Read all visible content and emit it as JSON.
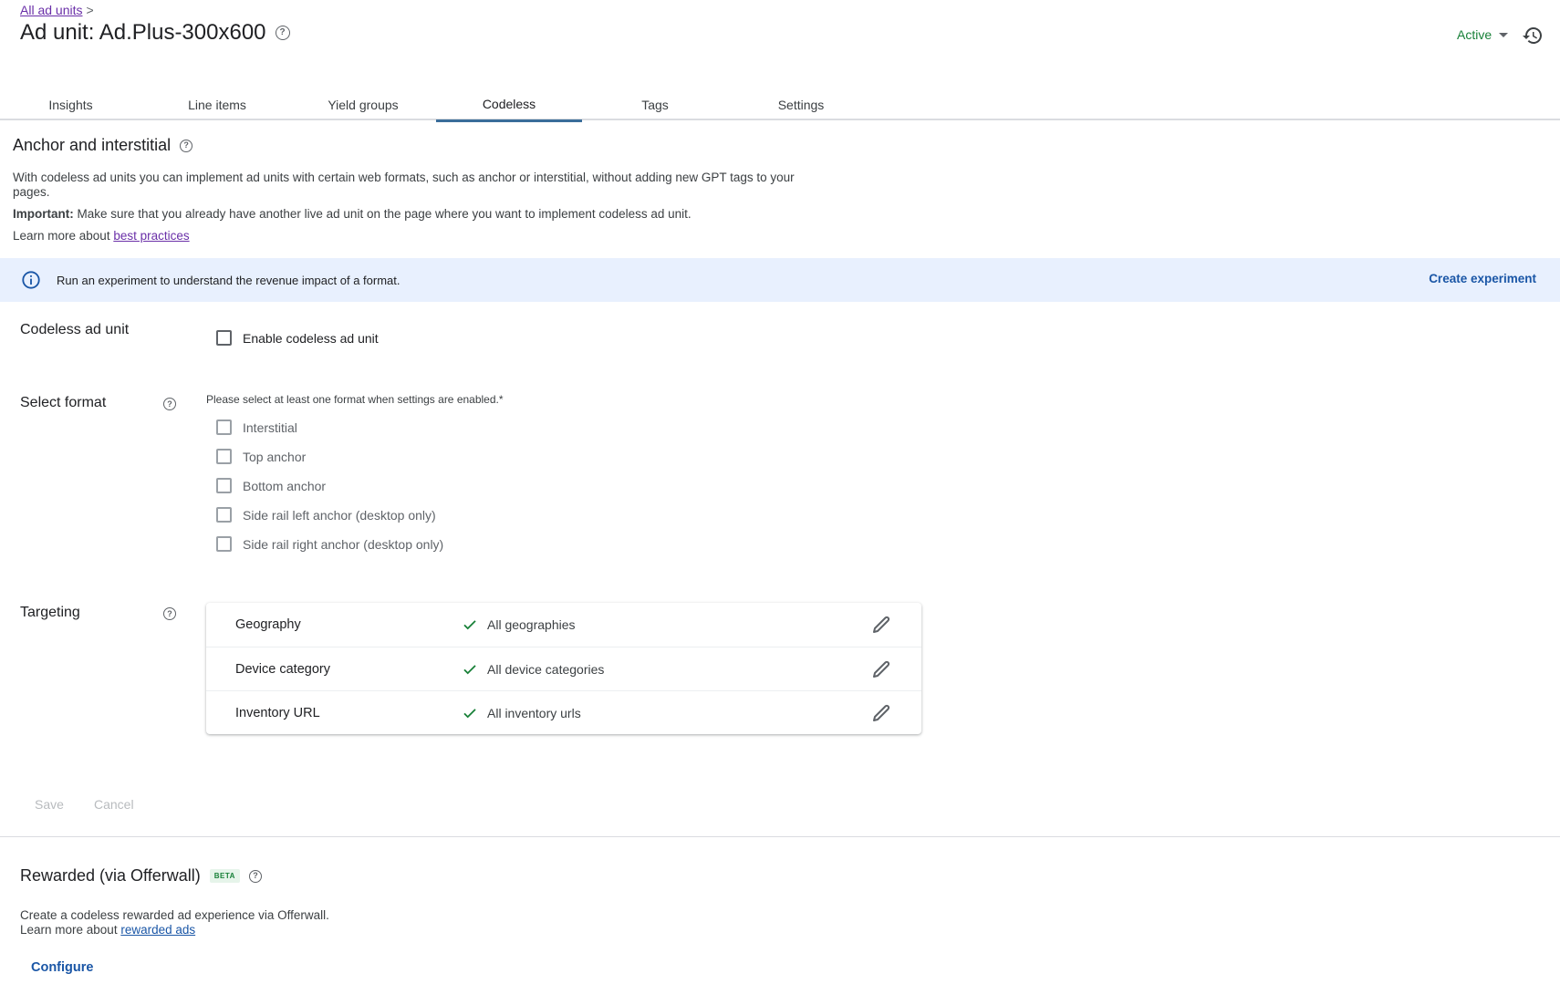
{
  "header": {
    "breadcrumb_label": "All ad units",
    "breadcrumb_separator": ">",
    "title": "Ad unit: Ad.Plus-300x600",
    "status": "Active",
    "status_color": "#188038"
  },
  "tabs": [
    {
      "label": "Insights",
      "active": false
    },
    {
      "label": "Line items",
      "active": false
    },
    {
      "label": "Yield groups",
      "active": false
    },
    {
      "label": "Codeless",
      "active": true
    },
    {
      "label": "Tags",
      "active": false
    },
    {
      "label": "Settings",
      "active": false
    }
  ],
  "anchor_section": {
    "title": "Anchor and interstitial",
    "description": "With codeless ad units you can implement ad units with certain web formats, such as anchor or interstitial, without adding new GPT tags to your pages.",
    "important_label": "Important:",
    "important_text": " Make sure that you already have another live ad unit on the page where you want to implement codeless ad unit.",
    "learn_more_prefix": "Learn more about ",
    "learn_more_link": "best practices"
  },
  "banner": {
    "icon": "info-icon",
    "text": "Run an experiment to understand the revenue impact of a format.",
    "action": "Create experiment"
  },
  "codeless_ad_unit": {
    "label": "Codeless ad unit",
    "checkbox_label": "Enable codeless ad unit",
    "checked": false
  },
  "select_format": {
    "label": "Select format",
    "hint": "Please select at least one format when settings are enabled.*",
    "options": [
      {
        "label": "Interstitial",
        "checked": false
      },
      {
        "label": "Top anchor",
        "checked": false
      },
      {
        "label": "Bottom anchor",
        "checked": false
      },
      {
        "label": "Side rail left anchor (desktop only)",
        "checked": false
      },
      {
        "label": "Side rail right anchor (desktop only)",
        "checked": false
      }
    ]
  },
  "targeting": {
    "label": "Targeting",
    "rows": [
      {
        "name": "Geography",
        "value": "All geographies"
      },
      {
        "name": "Device category",
        "value": "All device categories"
      },
      {
        "name": "Inventory URL",
        "value": "All inventory urls"
      }
    ]
  },
  "actions": {
    "save": "Save",
    "cancel": "Cancel"
  },
  "rewarded_section": {
    "title": "Rewarded (via Offerwall)",
    "badge": "BETA",
    "description": "Create a codeless rewarded ad experience via Offerwall.",
    "learn_more_prefix": "Learn more about ",
    "learn_more_link": "rewarded ads",
    "configure": "Configure"
  },
  "colors": {
    "accent_blue": "#1a56a6",
    "tab_indicator": "#3a6d9a",
    "banner_bg": "#e8f0fe",
    "check_green": "#188038",
    "link_purple": "#6a2fa8"
  }
}
